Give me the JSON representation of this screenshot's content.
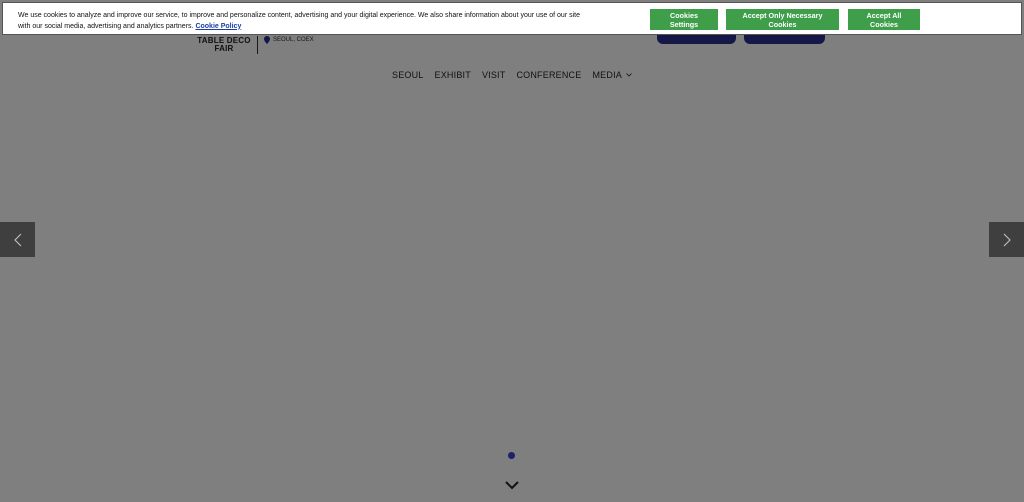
{
  "cookie_banner": {
    "text": "We use cookies to analyze and improve our service, to improve and personalize content, advertising and your digital experience. We also share information about your use of our site with our social media, advertising and analytics partners.",
    "policy_link": "Cookie Policy",
    "settings_label": "Cookies Settings",
    "necessary_label": "Accept Only Necessary Cookies",
    "accept_all_label": "Accept All Cookies",
    "button_color": "#3f9e4a"
  },
  "header": {
    "logo_line1": "TABLE DECO",
    "logo_line2": "FAIR",
    "location": "SEOUL, COEX",
    "location_icon": "map-pin-icon",
    "accent_color": "#2b2e8c"
  },
  "nav": {
    "items": [
      {
        "label": "SEOUL"
      },
      {
        "label": "EXHIBIT"
      },
      {
        "label": "VISIT"
      },
      {
        "label": "CONFERENCE"
      },
      {
        "label": "MEDIA",
        "icon": "chevron-down-icon"
      }
    ]
  },
  "slider": {
    "prev_icon": "chevron-left-icon",
    "next_icon": "chevron-right-icon",
    "scroll_icon": "chevron-down-icon",
    "dot_color": "#1f1f6b"
  }
}
